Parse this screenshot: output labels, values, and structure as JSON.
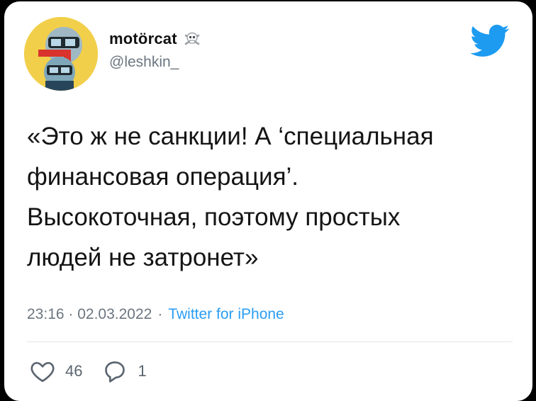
{
  "tweet": {
    "author": {
      "display_name": "motörcat",
      "handle": "@leshkin_"
    },
    "text": "«Это ж не санкции! А ‘специальная\nфинансовая операция’.\nВысокоточная, поэтому простых\nлюдей не затронет»",
    "timestamp": "23:16 · 02.03.2022",
    "separator": "·",
    "source": "Twitter for iPhone",
    "likes": "46",
    "replies": "1"
  },
  "icons": {
    "brand": "twitter-bird-icon",
    "name_emoji": "skull-crossbones-icon",
    "like": "heart-icon",
    "reply": "reply-bubble-icon"
  },
  "colors": {
    "twitter_blue": "#1d9bf0",
    "source_blue": "#2a9df4",
    "text": "#141414",
    "secondary_text": "#6b7680",
    "avatar_bg": "#f2cf4a"
  }
}
